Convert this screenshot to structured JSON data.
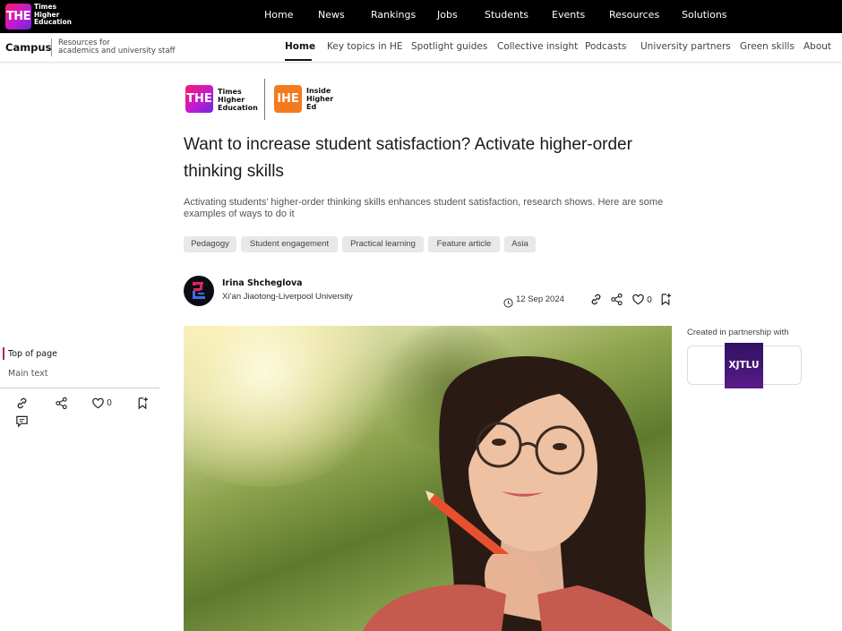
{
  "topbar": {
    "logo_abbr": "THE",
    "logo_lines": [
      "Times",
      "Higher",
      "Education"
    ],
    "nav": [
      "Home",
      "News",
      "Rankings",
      "Jobs",
      "Students",
      "Events",
      "Resources",
      "Solutions"
    ]
  },
  "subbar": {
    "brand": "Campus",
    "tagline_1": "Resources for",
    "tagline_2": "academics and university staff",
    "nav": [
      "Home",
      "Key topics in HE",
      "Spotlight guides",
      "Collective insight",
      "Podcasts",
      "University partners",
      "Green skills",
      "About"
    ],
    "active": "Home"
  },
  "logos": {
    "the_abbr": "THE",
    "the_text": [
      "Times",
      "Higher",
      "Education"
    ],
    "ihe_abbr": "IHE",
    "ihe_text": [
      "Inside",
      "Higher",
      "Ed"
    ]
  },
  "article": {
    "title": "Want to increase student satisfaction? Activate higher-order thinking skills",
    "standfirst": "Activating students’ higher-order thinking skills enhances student satisfaction, research shows. Here are some examples of ways to do it",
    "tags": [
      "Pedagogy",
      "Student engagement",
      "Practical learning",
      "Feature article",
      "Asia"
    ],
    "author_name": "Irina Shcheglova",
    "author_institution": "Xi’an Jiaotong-Liverpool University",
    "date": "12 Sep 2024",
    "likes": "0"
  },
  "sidebar": {
    "toc_top": "Top of page",
    "toc_main": "Main text",
    "likes": "0"
  },
  "partner": {
    "label": "Created in partnership with",
    "logo_text": "XJTLU"
  },
  "colors": {
    "accent": "#c2185b",
    "the_gradient_start": "#ff1a6b",
    "the_gradient_end": "#6a2bd8",
    "ihe_orange": "#f47a20",
    "xjtlu_purple": "#3d1570"
  }
}
